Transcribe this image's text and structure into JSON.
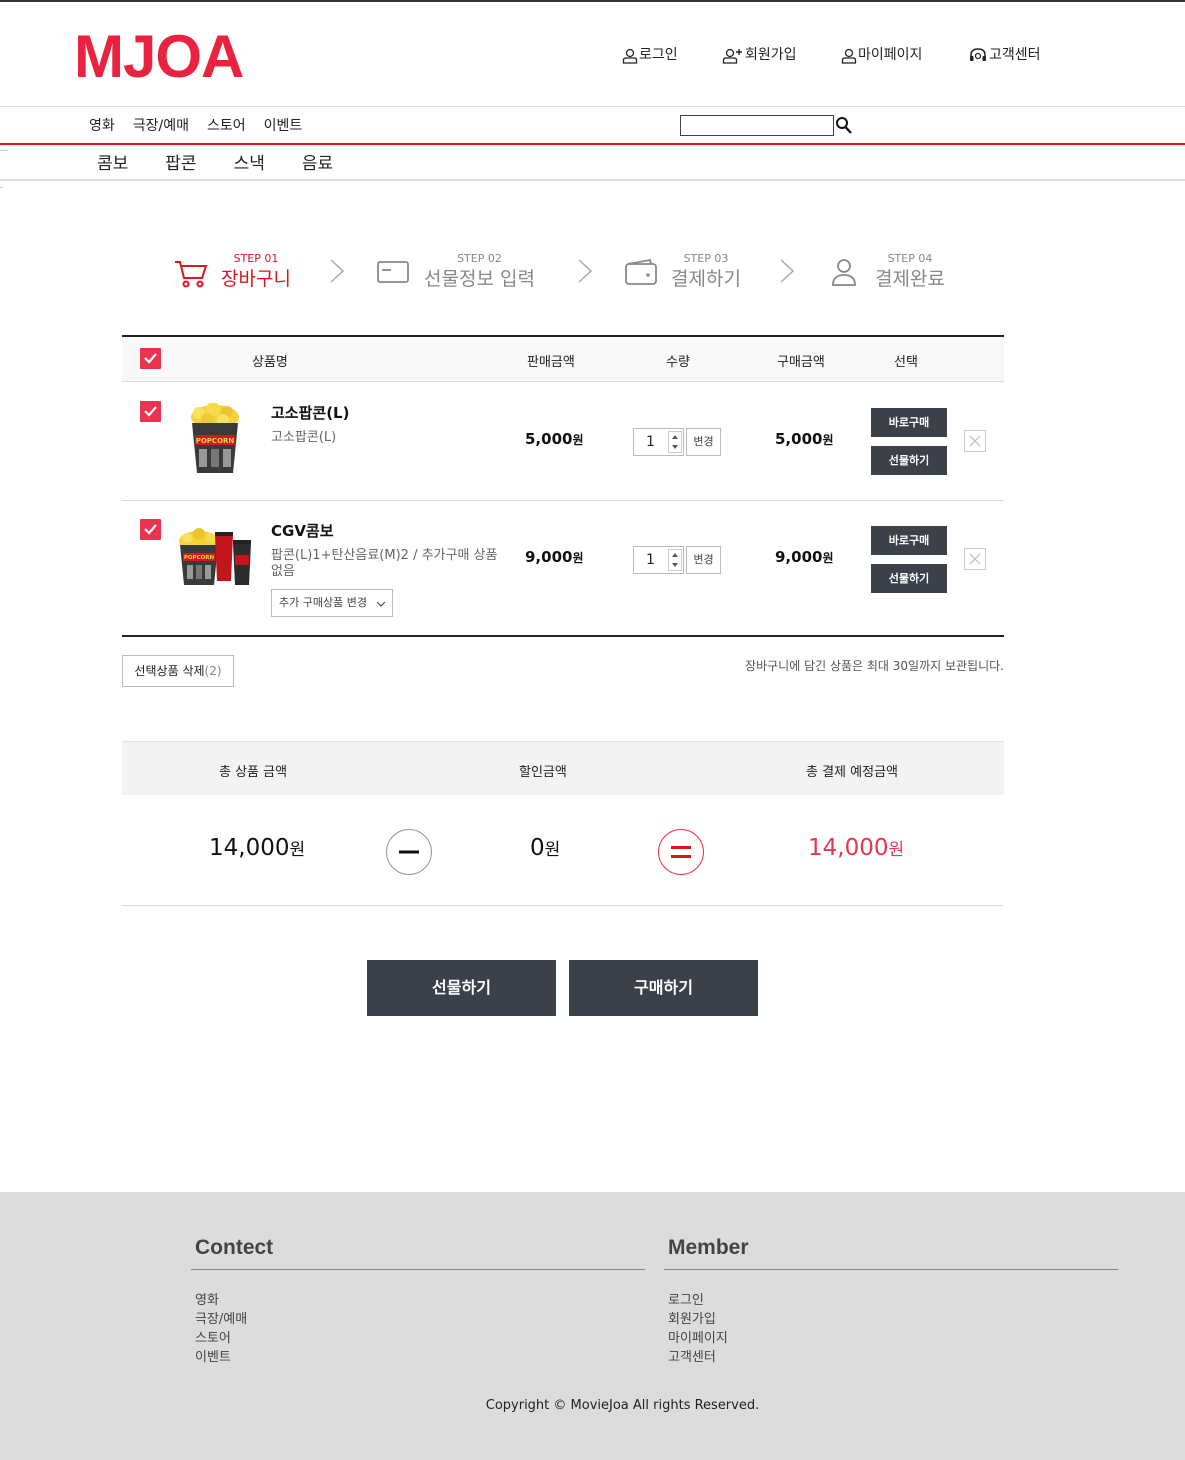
{
  "header": {
    "logo": "MJOA",
    "util": {
      "login": "로그인",
      "join": "회원가입",
      "mypage": "마이페이지",
      "service": "고객센터"
    }
  },
  "gnb": [
    "영화",
    "극장/예매",
    "스토어",
    "이벤트"
  ],
  "search": {
    "value": ""
  },
  "subnav": [
    "콤보",
    "팝콘",
    "스낵",
    "음료"
  ],
  "steps": [
    {
      "num": "STEP 01",
      "name": "장바구니",
      "icon": "cart-icon",
      "active": true
    },
    {
      "num": "STEP 02",
      "name": "선물정보 입력",
      "icon": "card-icon",
      "active": false
    },
    {
      "num": "STEP 03",
      "name": "결제하기",
      "icon": "wallet-icon",
      "active": false
    },
    {
      "num": "STEP 04",
      "name": "결제완료",
      "icon": "user-icon",
      "active": false
    }
  ],
  "table": {
    "headers": {
      "product": "상품명",
      "price": "판매금액",
      "qty": "수량",
      "total": "구매금액",
      "select": "선택"
    },
    "rows": [
      {
        "name": "고소팝콘(L)",
        "desc": "고소팝콘(L)",
        "price": "5,000",
        "unit": "원",
        "qty": "1",
        "change": "변경",
        "total": "5,000",
        "buy": "바로구매",
        "gift": "선물하기"
      },
      {
        "name": "CGV콤보",
        "desc": "팝콘(L)1+탄산음료(M)2 / 추가구매 상품 없음",
        "price": "9,000",
        "unit": "원",
        "qty": "1",
        "change": "변경",
        "total": "9,000",
        "buy": "바로구매",
        "gift": "선물하기",
        "add_option": "추가 구매상품 변경"
      }
    ]
  },
  "delete_selected": {
    "label": "선택상품 삭제",
    "count": "(2)"
  },
  "notice": "장바구니에 담긴 상품은 최대 30일까지 보관됩니다.",
  "summary": {
    "labels": {
      "total": "총 상품 금액",
      "discount": "할인금액",
      "pay": "총 결제 예정금액"
    },
    "total": "14,000",
    "discount": "0",
    "pay": "14,000",
    "unit": "원"
  },
  "actions": {
    "gift": "선물하기",
    "buy": "구매하기"
  },
  "footer": {
    "contect_title": "Contect",
    "contect": [
      "영화",
      "극장/예매",
      "스토어",
      "이벤트"
    ],
    "member_title": "Member",
    "member": [
      "로그인",
      "회원가입",
      "마이페이지",
      "고객센터"
    ],
    "copyright": "Copyright © MovieJoa All rights Reserved."
  },
  "colors": {
    "brand": "#e8223f",
    "accent_line": "#d7171f",
    "dark_button": "#3c4048",
    "checkbox": "#e8344e"
  }
}
